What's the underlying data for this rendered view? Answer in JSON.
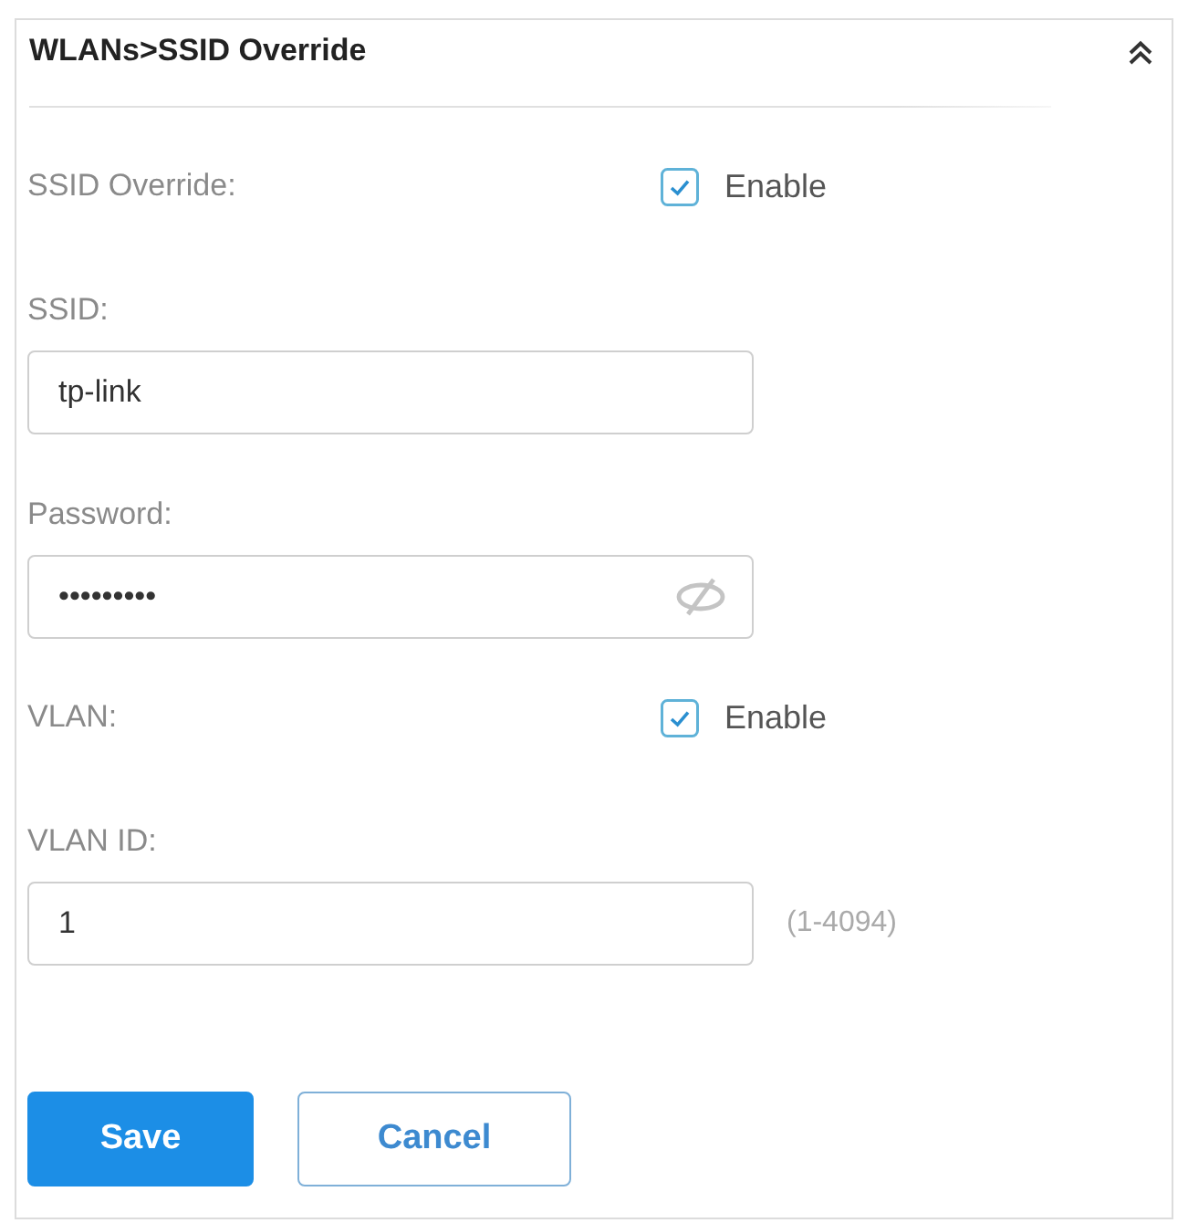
{
  "panel": {
    "title": "WLANs>SSID Override"
  },
  "fields": [
    {
      "kind": "checkbox",
      "label": "SSID Override:",
      "option": "Enable",
      "checked": true
    },
    {
      "kind": "text",
      "label": "SSID:",
      "value": "tp-link"
    },
    {
      "kind": "password",
      "label": "Password:",
      "value": "•••••••••"
    },
    {
      "kind": "checkbox",
      "label": "VLAN:",
      "option": "Enable",
      "checked": true
    },
    {
      "kind": "text",
      "label": "VLAN ID:",
      "value": "1",
      "hint": "(1-4094)"
    }
  ],
  "buttons": [
    {
      "label": "Save",
      "kind": "primary"
    },
    {
      "label": "Cancel",
      "kind": "secondary"
    }
  ]
}
